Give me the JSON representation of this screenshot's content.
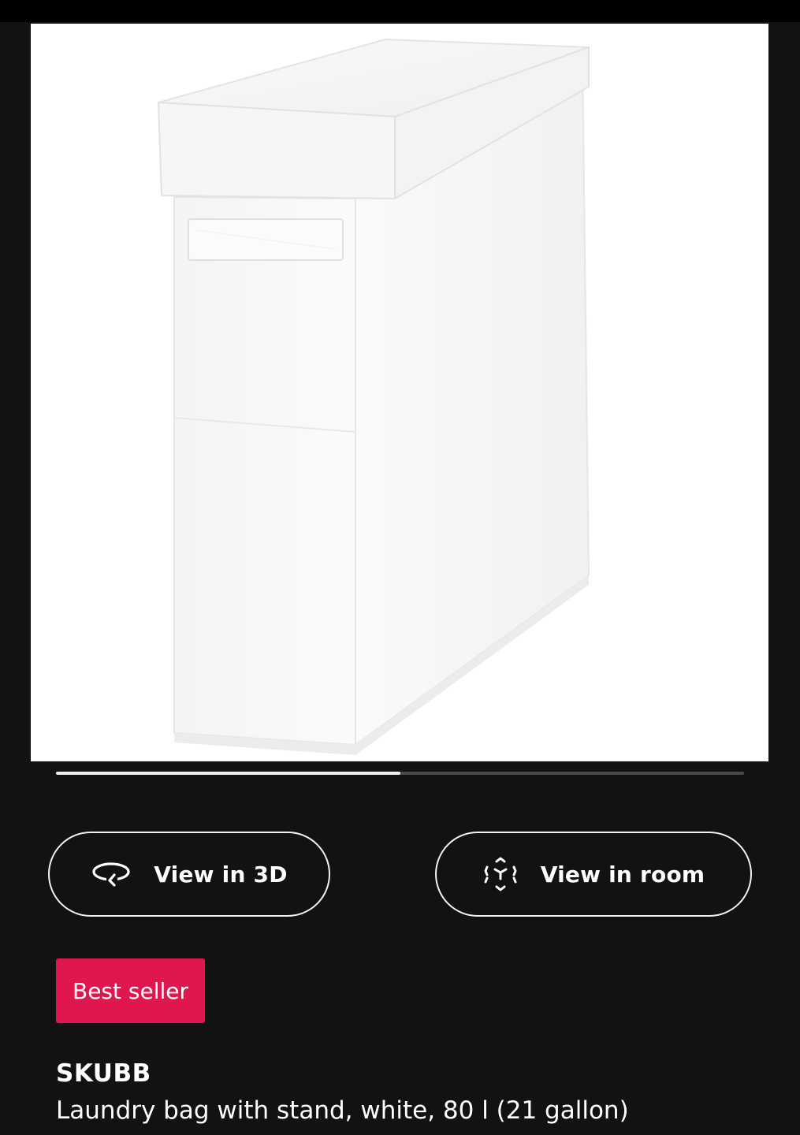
{
  "product_image": {
    "alt_icon": "laundry-bag-image",
    "background": "#ffffff"
  },
  "carousel": {
    "progress_fraction": 0.5
  },
  "actions": {
    "view_3d_label": "View in 3D",
    "view_3d_icon": "rotate-3d-icon",
    "view_room_label": "View in room",
    "view_room_icon": "ar-cube-icon"
  },
  "badge": {
    "label": "Best seller",
    "color": "#e0174f"
  },
  "product": {
    "name": "SKUBB",
    "description": "Laundry bag with stand, white, 80 l (21 gallon)"
  }
}
